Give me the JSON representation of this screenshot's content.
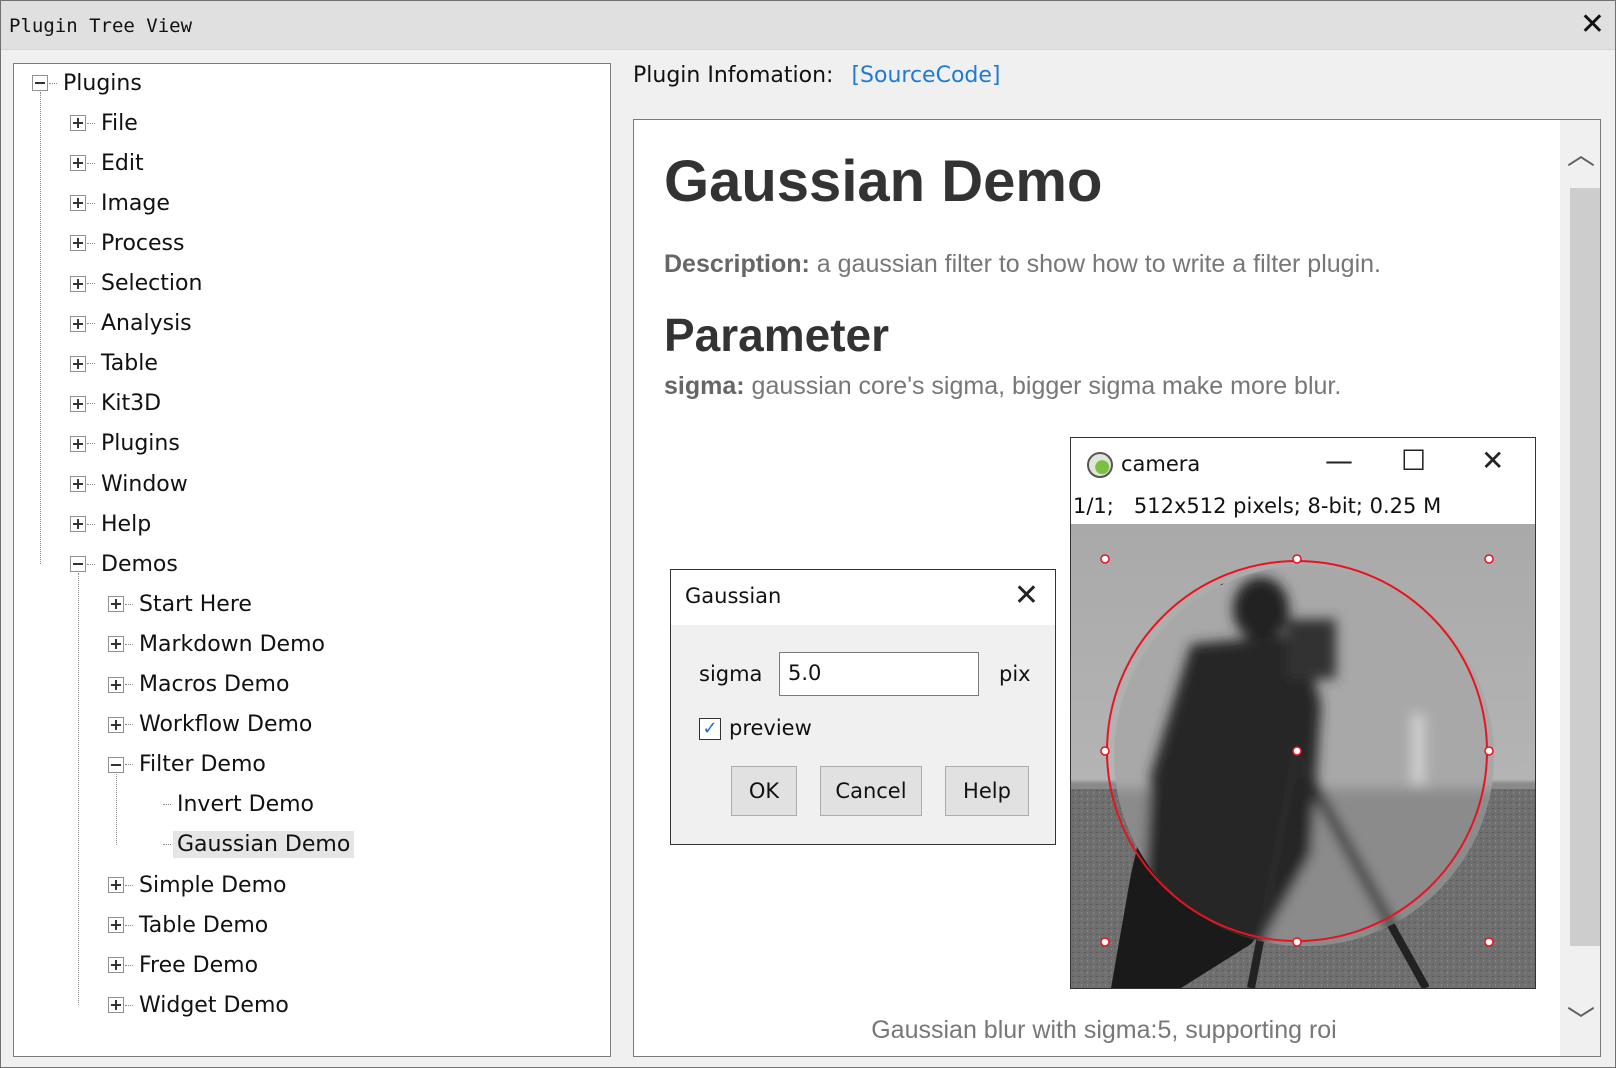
{
  "window": {
    "title": "Plugin Tree View",
    "close_icon": "close-icon"
  },
  "tree": {
    "root": "Plugins",
    "top_items": [
      "File",
      "Edit",
      "Image",
      "Process",
      "Selection",
      "Analysis",
      "Table",
      "Kit3D",
      "Plugins",
      "Window",
      "Help",
      "Demos"
    ],
    "demos_items": [
      "Start Here",
      "Markdown Demo",
      "Macros Demo",
      "Workflow Demo",
      "Filter Demo",
      "Simple Demo",
      "Table Demo",
      "Free Demo",
      "Widget Demo"
    ],
    "filter_children": [
      "Invert Demo",
      "Gaussian Demo"
    ],
    "selected": "Gaussian Demo"
  },
  "info": {
    "label": "Plugin Infomation:",
    "source_link": "[SourceCode]",
    "link_color": "#1e7bd3"
  },
  "doc": {
    "title": "Gaussian Demo",
    "description_label": "Description:",
    "description_text": " a gaussian filter to show how to write a filter plugin.",
    "parameter_heading": "Parameter",
    "sigma_label": "sigma:",
    "sigma_text": " gaussian core's sigma, bigger sigma make more blur.",
    "caption": "Gaussian blur with sigma:5, supporting roi"
  },
  "gaussian_dialog": {
    "title": "Gaussian",
    "sigma_label": "sigma",
    "sigma_value": "5.0",
    "unit": "pix",
    "preview_label": "preview",
    "preview_checked": true,
    "ok": "OK",
    "cancel": "Cancel",
    "help": "Help"
  },
  "camera_window": {
    "title": "camera",
    "info": "1/1;   512x512 pixels; 8-bit; 0.25 M",
    "roi_color": "#e8131f"
  }
}
